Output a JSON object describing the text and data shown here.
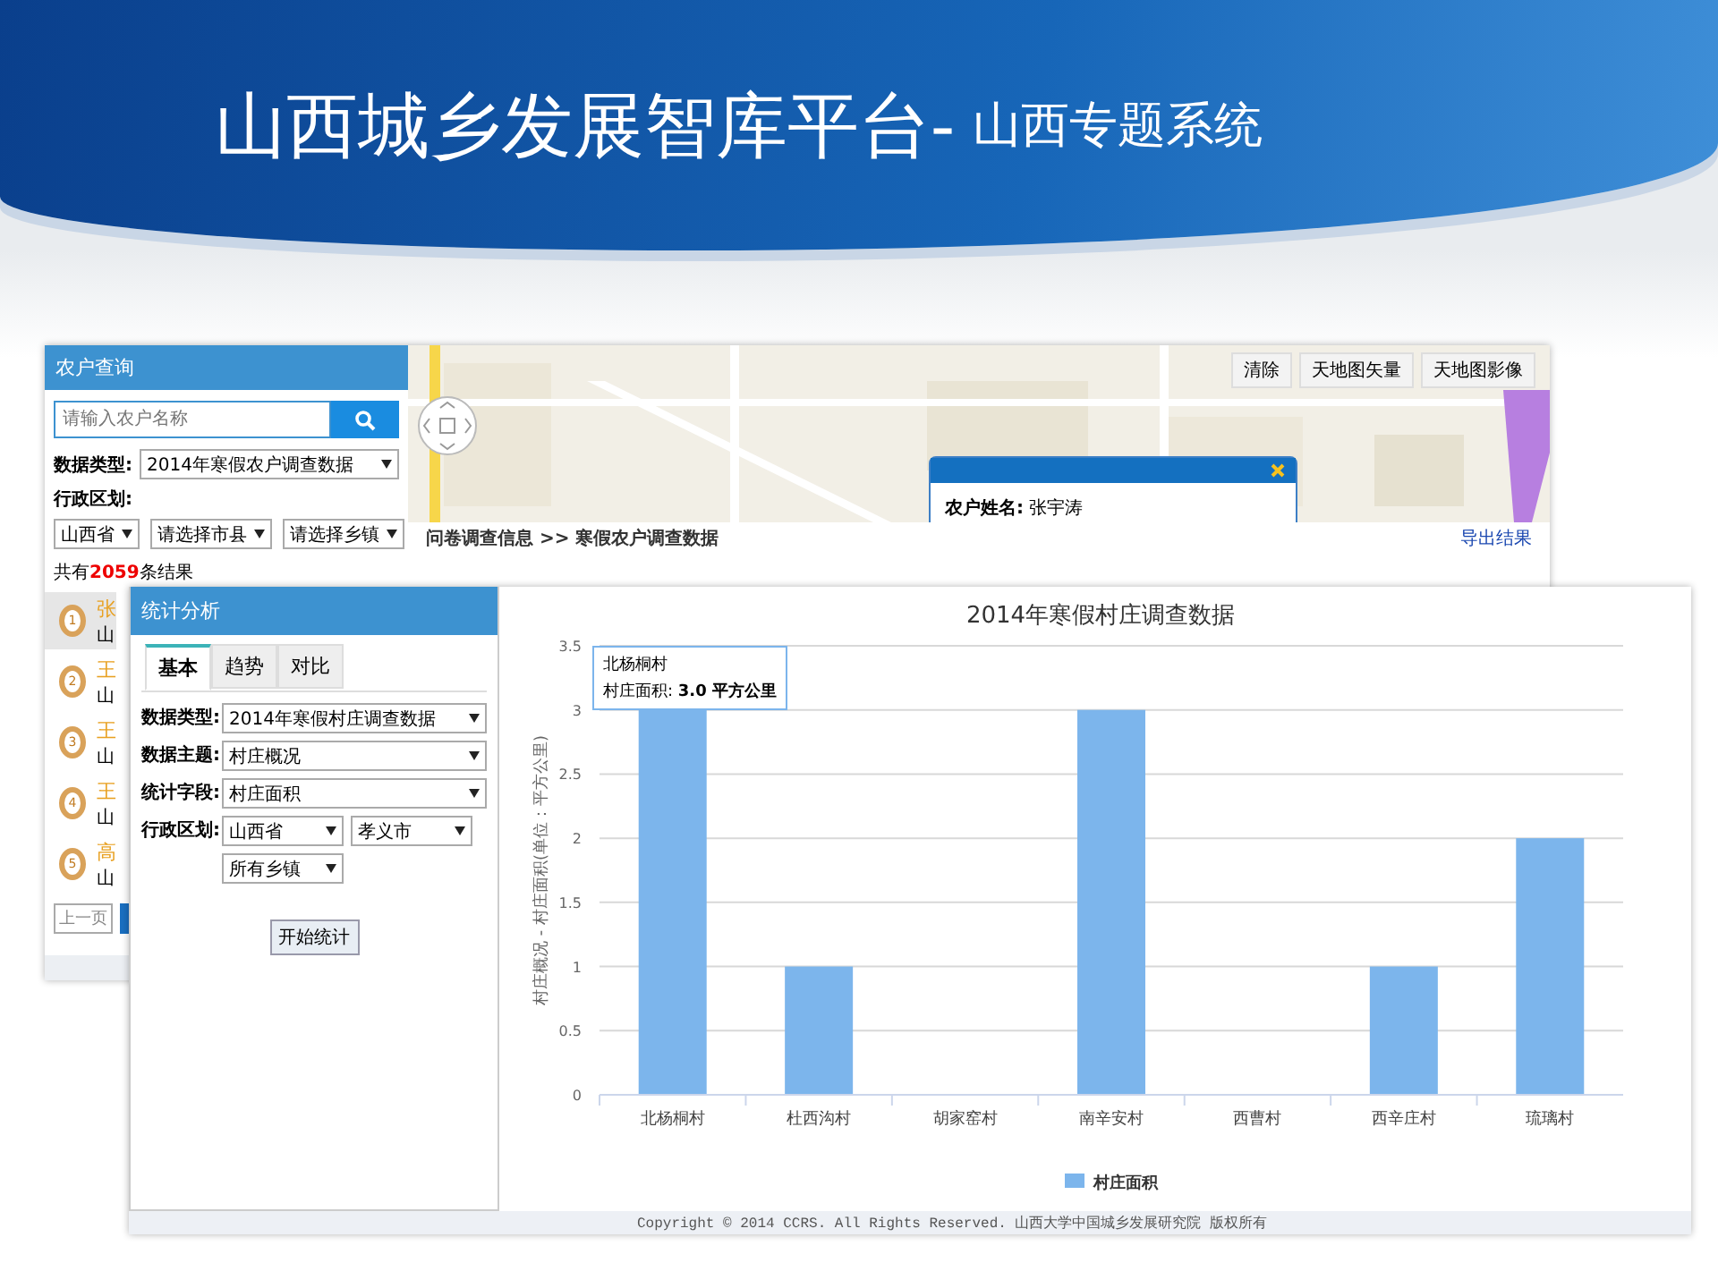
{
  "slide": {
    "title": "山西城乡发展智库平台-",
    "subtitle": "山西专题系统"
  },
  "back_window": {
    "title": "农户查询",
    "search": {
      "placeholder": "请输入农户名称"
    },
    "data_type": {
      "label": "数据类型:",
      "value": "2014年寒假农户调查数据"
    },
    "region_label": "行政区划:",
    "region_selects": [
      "山西省",
      "请选择市县",
      "请选择乡镇"
    ],
    "result_count": {
      "prefix": "共有",
      "number": "2059",
      "suffix": "条结果"
    },
    "results": [
      {
        "number": "1",
        "name": "张",
        "place": "山",
        "selected": true
      },
      {
        "number": "2",
        "name": "王",
        "place": "山",
        "selected": false
      },
      {
        "number": "3",
        "name": "王",
        "place": "山",
        "selected": false
      },
      {
        "number": "4",
        "name": "王",
        "place": "山",
        "selected": false
      },
      {
        "number": "5",
        "name": "高",
        "place": "山",
        "selected": false
      }
    ],
    "pager": {
      "prev": "上一页"
    },
    "map_buttons": [
      "清除",
      "天地图矢量",
      "天地图影像"
    ],
    "popup": {
      "label": "农户姓名:",
      "value": "张宇涛"
    },
    "breadcrumb": "问卷调查信息 >> 寒假农户调查数据",
    "export_link": "导出结果"
  },
  "front_window": {
    "title": "统计分析",
    "tabs": [
      {
        "label": "基本",
        "selected": true
      },
      {
        "label": "趋势",
        "selected": false
      },
      {
        "label": "对比",
        "selected": false
      }
    ],
    "fields": [
      {
        "label": "数据类型:",
        "selects": [
          "2014年寒假村庄调查数据"
        ]
      },
      {
        "label": "数据主题:",
        "selects": [
          "村庄概况"
        ]
      },
      {
        "label": "统计字段:",
        "selects": [
          "村庄面积"
        ]
      },
      {
        "label": "行政区划:",
        "selects": [
          "山西省",
          "孝义市",
          "所有乡镇"
        ]
      }
    ],
    "start_button": "开始统计",
    "chart_data": {
      "type": "bar",
      "title": "2014年寒假村庄调查数据",
      "ylabel": "村庄概况 - 村庄面积(单位：平方公里)",
      "categories": [
        "北杨桐村",
        "杜西沟村",
        "胡家窑村",
        "南辛安村",
        "西曹村",
        "西辛庄村",
        "琉璃村"
      ],
      "series": [
        {
          "name": "村庄面积",
          "color": "#7cb5ec",
          "values": [
            3,
            1,
            0,
            3,
            0,
            1,
            2
          ]
        }
      ],
      "grid": true,
      "ylim": [
        0,
        3.5
      ],
      "yticks": [
        0,
        0.5,
        1,
        1.5,
        2,
        2.5,
        3,
        3.5
      ]
    },
    "tooltip": {
      "title": "北杨桐村",
      "line": "村庄面积: **3.0 平方公里**"
    },
    "footer": "Copyright © 2014 CCRS. All Rights Reserved. 山西大学中国城乡发展研究院 版权所有"
  }
}
